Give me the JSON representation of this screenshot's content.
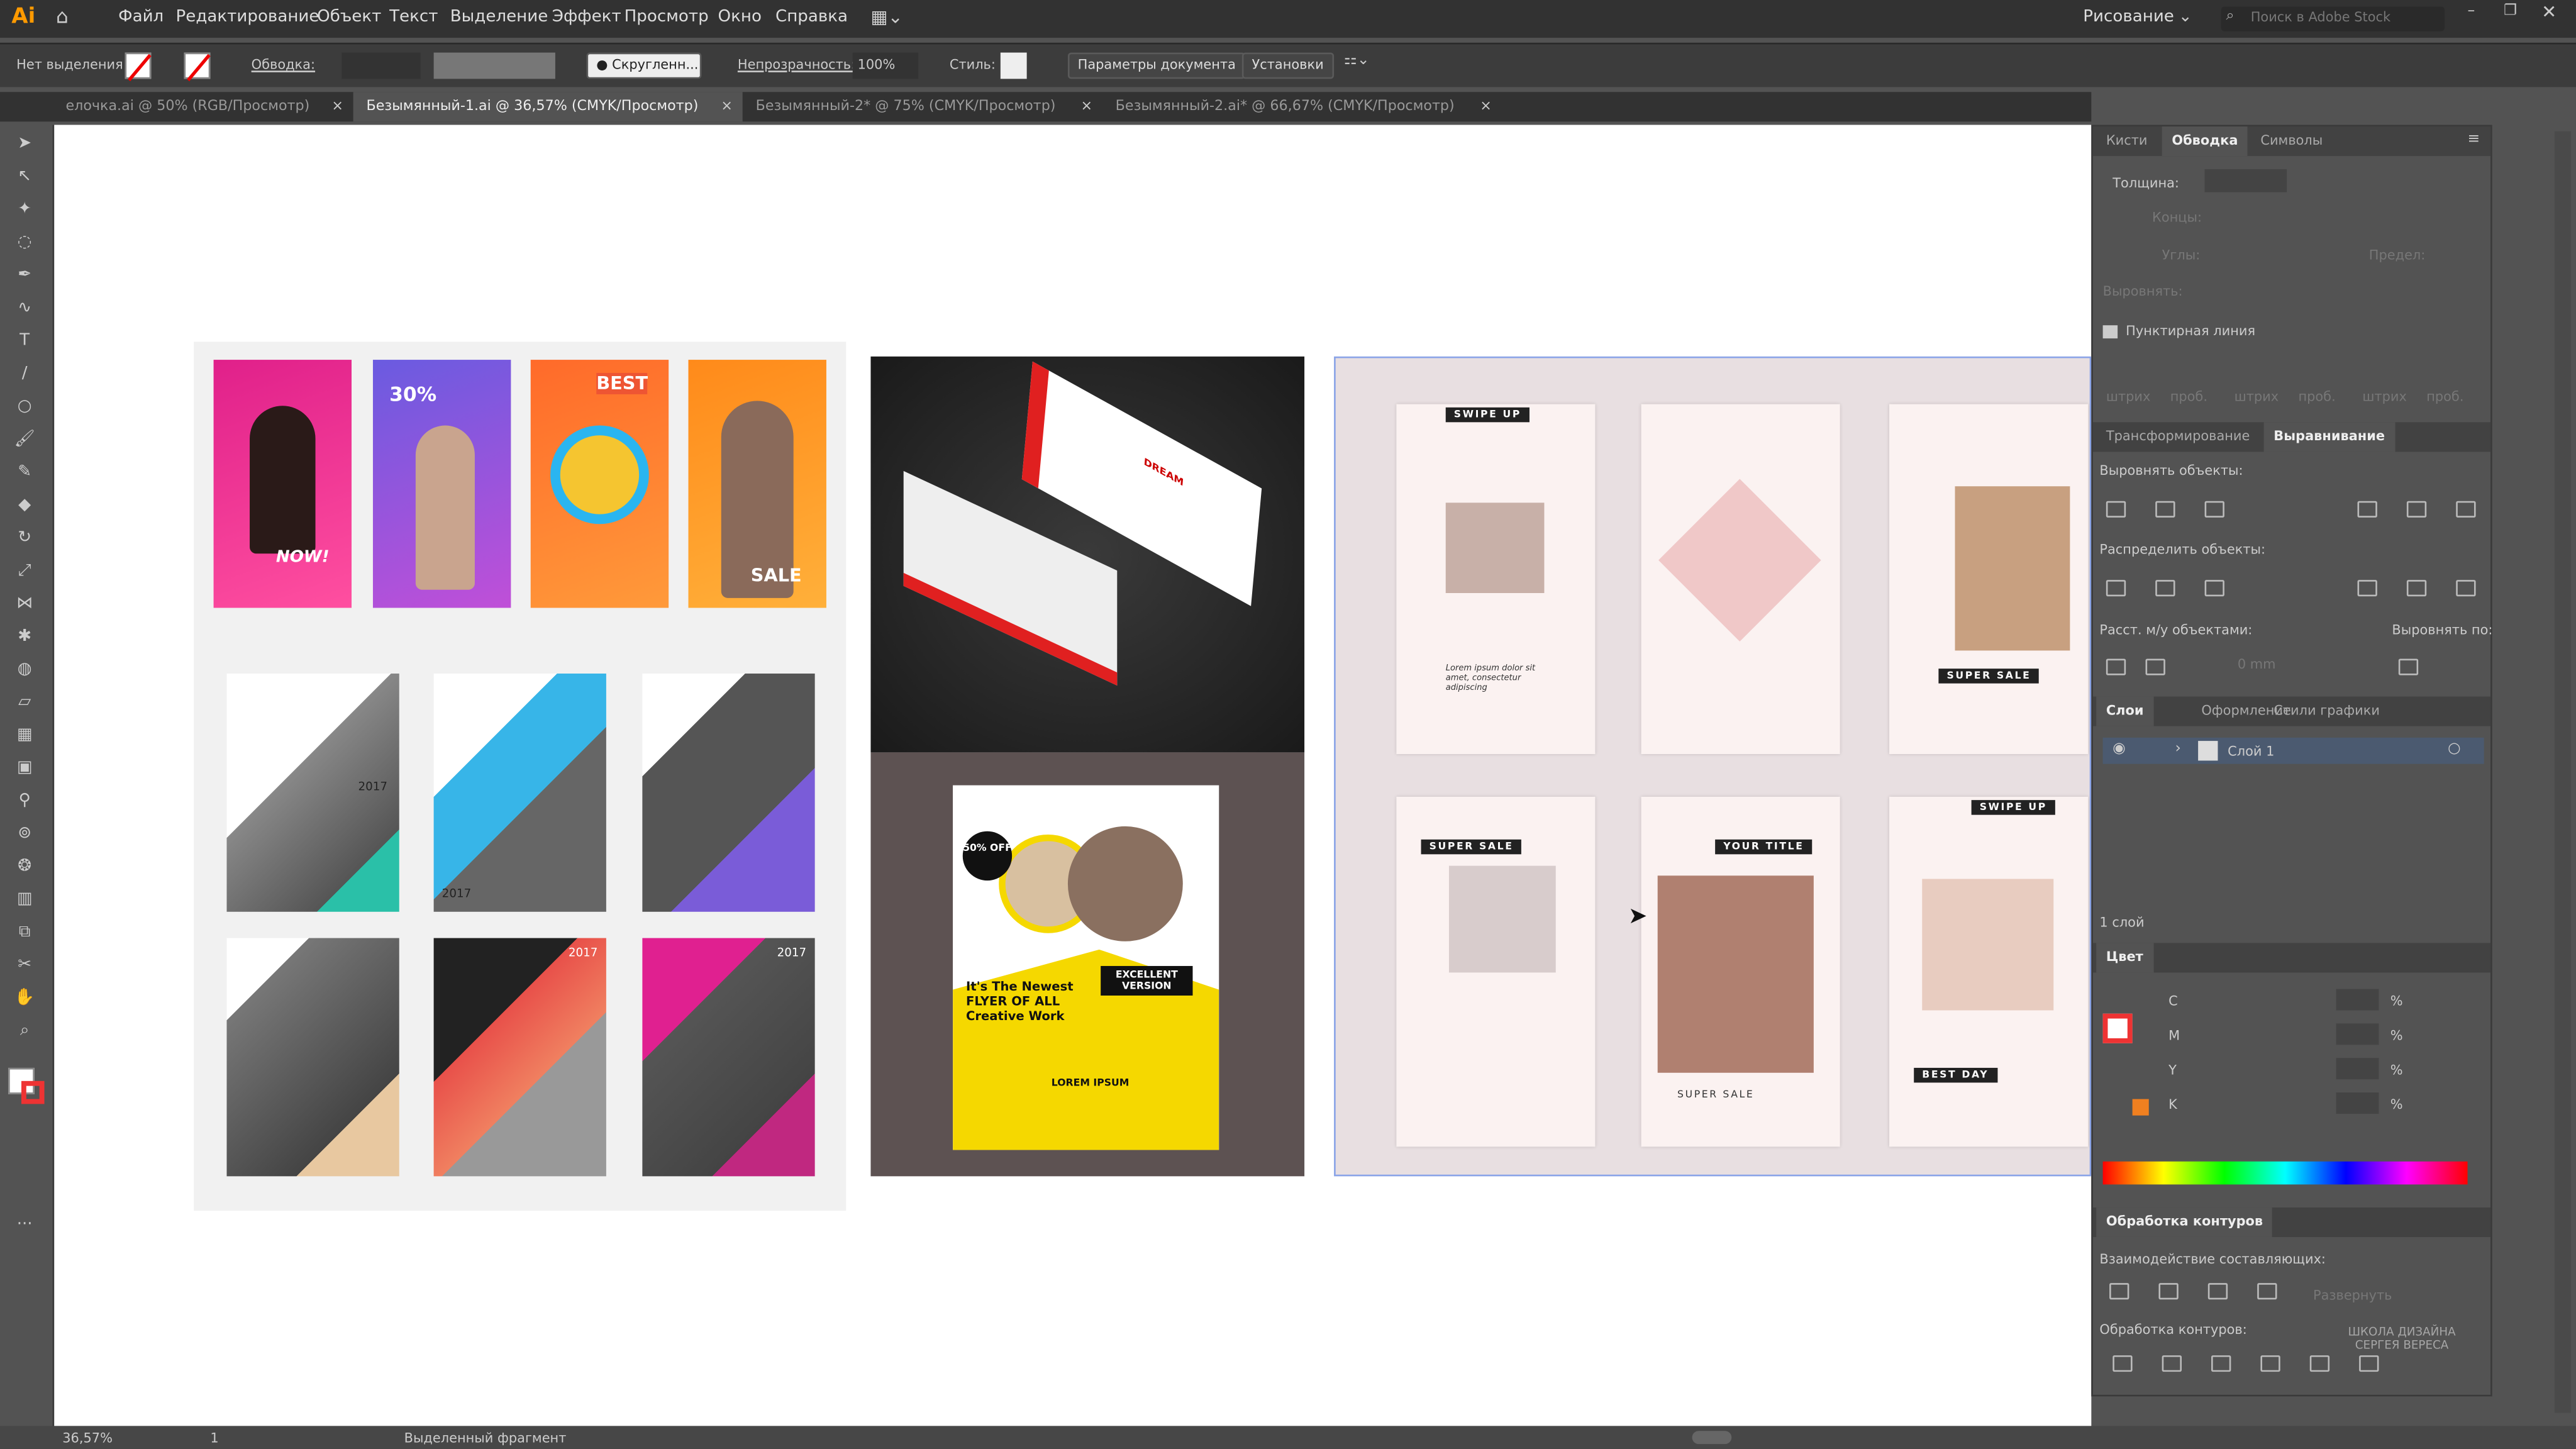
{
  "app": {
    "logo": "Ai",
    "menu": [
      "Файл",
      "Редактирование",
      "Объект",
      "Текст",
      "Выделение",
      "Эффект",
      "Просмотр",
      "Окно",
      "Справка"
    ],
    "workspace": "Рисование",
    "search_placeholder": "Поиск в Adobe Stock"
  },
  "control": {
    "selection": "Нет выделения",
    "stroke_label": "Обводка:",
    "brush": "Скругленн...",
    "opacity_label": "Непрозрачность:",
    "opacity": "100%",
    "style_label": "Стиль:",
    "doc_params": "Параметры документа",
    "prefs": "Установки"
  },
  "tabs": [
    {
      "label": "елочка.ai @ 50% (RGB/Просмотр)"
    },
    {
      "label": "Безымянный-1.ai @ 36,57% (CMYK/Просмотр)"
    },
    {
      "label": "Безымянный-2* @ 75% (CMYK/Просмотр)"
    },
    {
      "label": "Безымянный-2.ai* @ 66,67% (CMYK/Просмотр)"
    }
  ],
  "panels": {
    "stroke": {
      "tabs": [
        "Кисти",
        "Обводка",
        "Символы"
      ],
      "weight": "Толщина:",
      "cap": "Концы:",
      "corner": "Углы:",
      "limit": "Предел:",
      "align": "Выровнять:",
      "dashed": "Пунктирная линия",
      "dash_labels": [
        "штрих",
        "проб.",
        "штрих",
        "проб.",
        "штрих",
        "проб."
      ]
    },
    "align": {
      "tabs": [
        "Трансформирование",
        "Выравнивание"
      ],
      "align_objects": "Выровнять объекты:",
      "distribute_objects": "Распределить объекты:",
      "distribute_spacing": "Расст. м/у объектами:",
      "align_to": "Выровнять по:",
      "spacing_value": "0 mm"
    },
    "layers": {
      "tabs": [
        "Слои",
        "Оформление",
        "Стили графики"
      ],
      "layer_name": "Слой 1",
      "count": "1 слой"
    },
    "color": {
      "title": "Цвет",
      "channels": [
        "C",
        "M",
        "Y",
        "K"
      ],
      "unit": "%"
    },
    "pathfinder": {
      "title": "Обработка контуров",
      "shape_modes": "Взаимодействие составляющих:",
      "pathfinders": "Обработка контуров:",
      "expand": "Развернуть"
    }
  },
  "watermark": "ШКОЛА ДИЗАЙНА СЕРГЕЯ ВЕРЕСА",
  "status": {
    "zoom": "36,57%",
    "artboard": "1",
    "tool": "Выделенный фрагмент"
  },
  "art": {
    "p1": "30%",
    "p2": "BEST",
    "p3": "NOW!",
    "p4": "SALE",
    "year": "2017",
    "flyer_off": "50% OFF",
    "flyer_title": "It's The Newest FLYER OF ALL Creative Work",
    "flyer_badge": "EXCELLENT VERSION",
    "flyer_lorem": "LOREM IPSUM",
    "swipe": "SWIPE UP",
    "super_sale": "SUPER SALE",
    "your_title": "YOUR TITLE",
    "best_day": "BEST DAY",
    "lorem": "Lorem ipsum dolor sit amet, consectetur adipiscing",
    "bc": "DREAM"
  },
  "colors": {
    "accent": "#2d8ceb",
    "selection": "#4a7fd8",
    "ai_logo": "#ff9a00"
  }
}
